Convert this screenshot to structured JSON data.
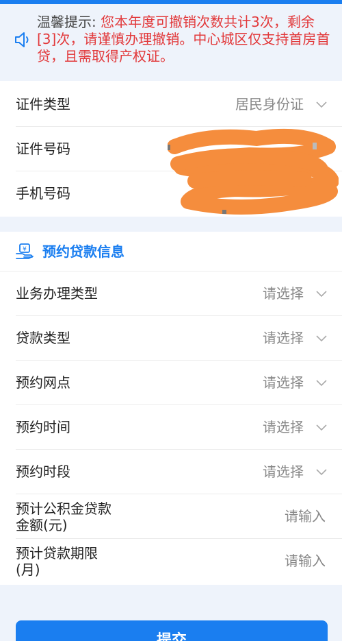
{
  "notice": {
    "label": "温馨提示:",
    "message": "您本年度可撤销次数共计3次，剩余[3]次，请谨慎办理撤销。中心城区仅支持首房首贷，且需取得产权证。"
  },
  "identity": {
    "id_type_label": "证件类型",
    "id_type_value": "居民身份证",
    "id_number_label": "证件号码",
    "phone_label": "手机号码"
  },
  "loan_section": {
    "title": "预约贷款信息",
    "rows": [
      {
        "label": "业务办理类型",
        "value": "请选择"
      },
      {
        "label": "贷款类型",
        "value": "请选择"
      },
      {
        "label": "预约网点",
        "value": "请选择"
      },
      {
        "label": "预约时间",
        "value": "请选择"
      },
      {
        "label": "预约时段",
        "value": "请选择"
      }
    ],
    "amount_label": "预计公积金贷款金额(元)",
    "amount_placeholder": "请输入",
    "term_label": "预计贷款期限(月)",
    "term_placeholder": "请输入"
  },
  "submit_label": "提交",
  "colors": {
    "accent": "#1a7ef0",
    "warning": "#e2383a",
    "redaction": "#f58d3d"
  },
  "icons": {
    "notice": "speaker-icon",
    "section": "loan-money-icon",
    "dropdown": "chevron-down-icon"
  }
}
